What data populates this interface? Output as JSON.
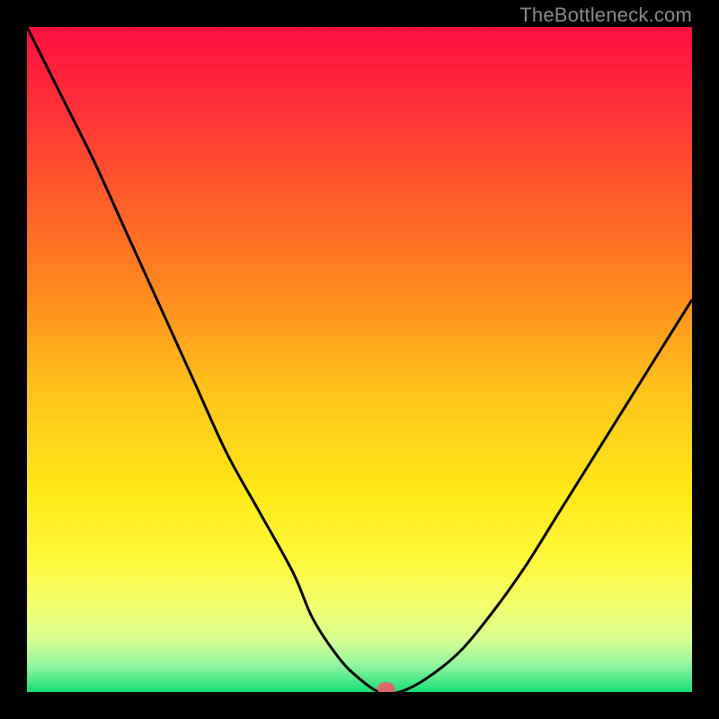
{
  "attribution": "TheBottleneck.com",
  "chart_data": {
    "type": "line",
    "title": "",
    "xlabel": "",
    "ylabel": "",
    "xlim": [
      0,
      100
    ],
    "ylim": [
      0,
      100
    ],
    "series": [
      {
        "name": "bottleneck-curve",
        "x": [
          0,
          5,
          10,
          15,
          20,
          25,
          30,
          35,
          40,
          43,
          47,
          50,
          53,
          56,
          60,
          65,
          70,
          75,
          80,
          85,
          90,
          95,
          100
        ],
        "values": [
          100,
          90,
          80,
          69,
          58,
          47,
          36,
          27,
          18,
          11,
          5,
          2,
          0,
          0,
          2,
          6,
          12,
          19,
          27,
          35,
          43,
          51,
          59
        ]
      }
    ],
    "marker": {
      "x": 54,
      "y": 0
    },
    "gradient_stops": [
      {
        "offset": 0.0,
        "color": "#ff1040"
      },
      {
        "offset": 0.1,
        "color": "#ff2a3a"
      },
      {
        "offset": 0.25,
        "color": "#ff5a2a"
      },
      {
        "offset": 0.4,
        "color": "#ff8a1e"
      },
      {
        "offset": 0.55,
        "color": "#ffc41a"
      },
      {
        "offset": 0.7,
        "color": "#ffe918"
      },
      {
        "offset": 0.8,
        "color": "#fff93a"
      },
      {
        "offset": 0.87,
        "color": "#f3ff6e"
      },
      {
        "offset": 0.92,
        "color": "#d9ff90"
      },
      {
        "offset": 0.96,
        "color": "#90f5a0"
      },
      {
        "offset": 1.0,
        "color": "#18df78"
      }
    ],
    "marker_color": "#d96a6a",
    "line_color": "#000000"
  }
}
